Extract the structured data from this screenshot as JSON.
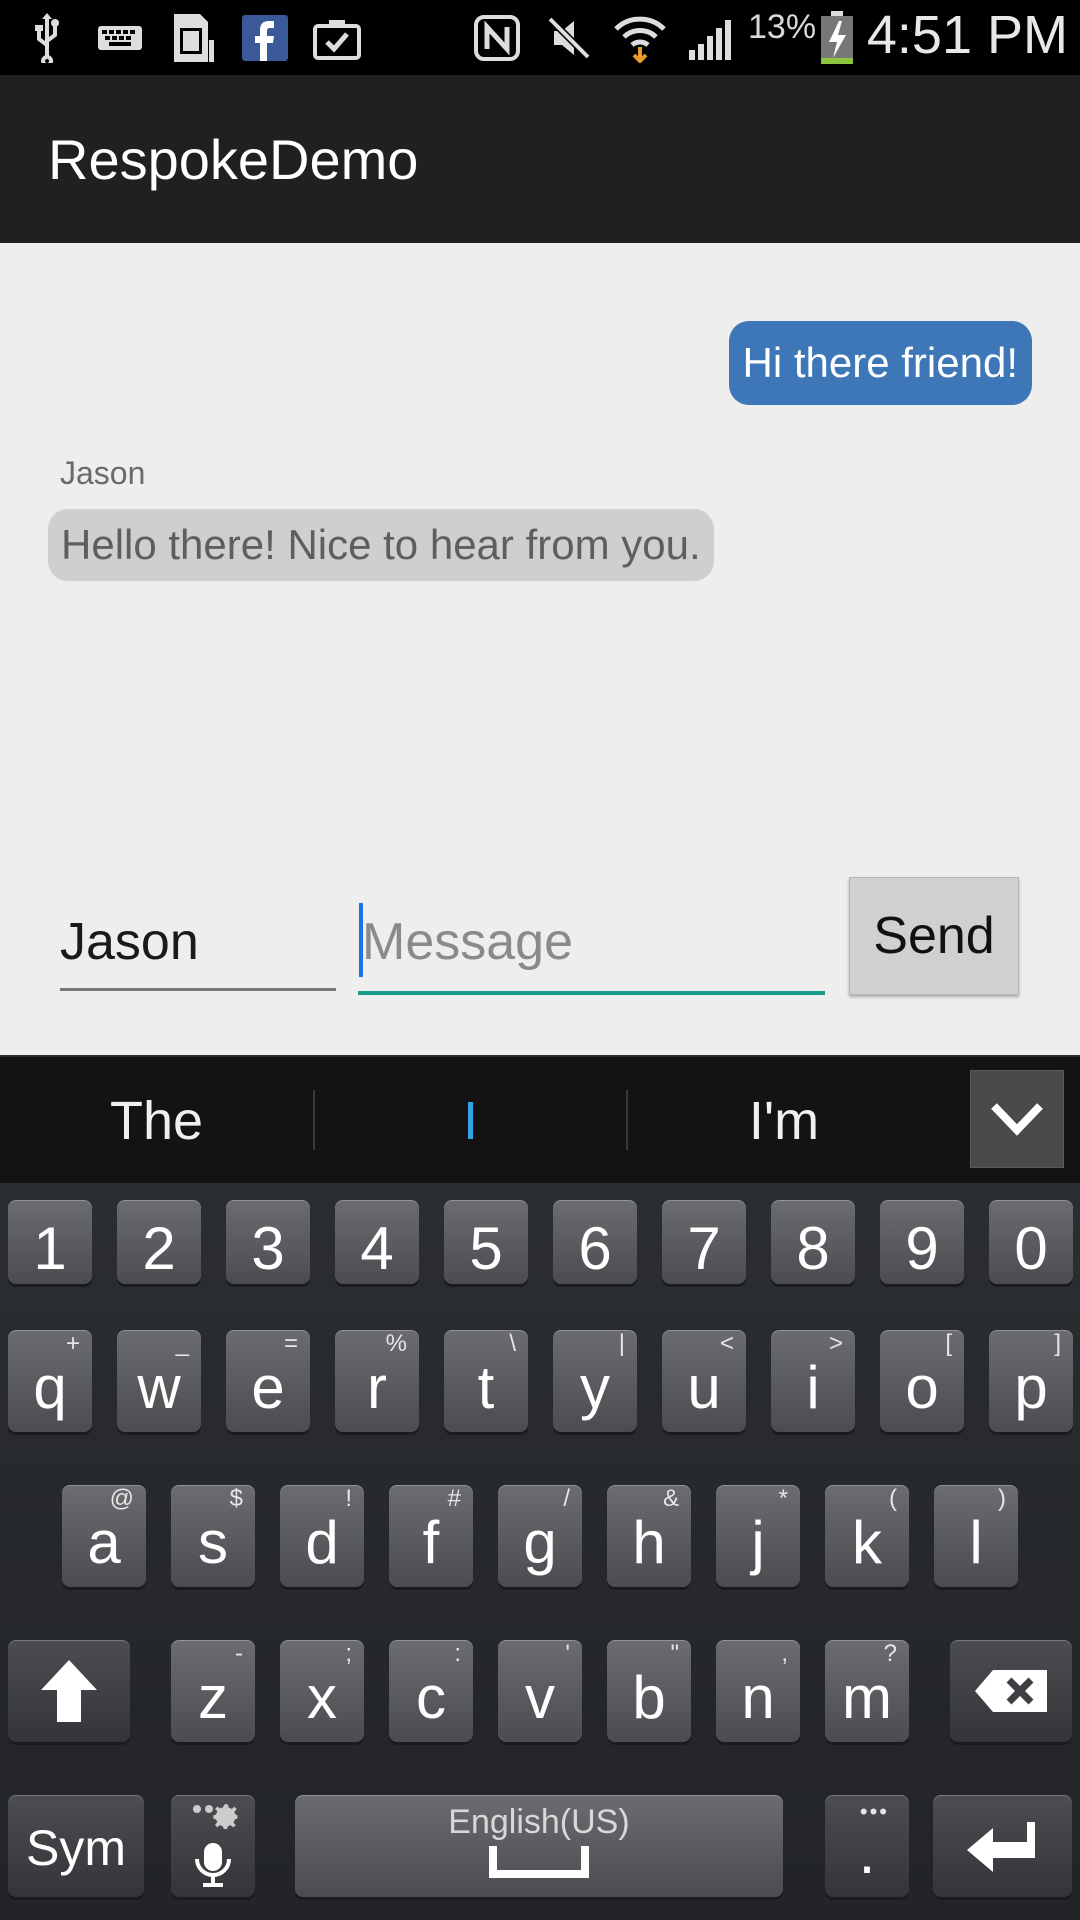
{
  "status_bar": {
    "icons": [
      "usb-icon",
      "keyboard-icon",
      "sd-card-icon",
      "facebook-icon",
      "clipboard-check-icon",
      "nfc-icon",
      "mute-icon",
      "wifi-icon",
      "signal-icon",
      "battery-charging-icon"
    ],
    "battery_percent": "13%",
    "time": "4:51 PM",
    "battery_level": 0.13
  },
  "action_bar": {
    "title": "RespokeDemo"
  },
  "chat": {
    "messages": [
      {
        "direction": "outgoing",
        "text": "Hi there friend!",
        "color": "#3d77b8"
      },
      {
        "direction": "incoming",
        "sender": "Jason",
        "text": "Hello there! Nice to hear from you.",
        "color": "#cfcfcf"
      }
    ]
  },
  "composer": {
    "name_value": "Jason",
    "message_placeholder": "Message",
    "send_label": "Send",
    "accent_color": "#169b8c"
  },
  "keyboard": {
    "suggestions": [
      "The",
      "I",
      "I'm"
    ],
    "number_row": [
      "1",
      "2",
      "3",
      "4",
      "5",
      "6",
      "7",
      "8",
      "9",
      "0"
    ],
    "row1": [
      {
        "key": "q",
        "hint": "+"
      },
      {
        "key": "w",
        "hint": "_"
      },
      {
        "key": "e",
        "hint": "="
      },
      {
        "key": "r",
        "hint": "%"
      },
      {
        "key": "t",
        "hint": "\\"
      },
      {
        "key": "y",
        "hint": "|"
      },
      {
        "key": "u",
        "hint": "<"
      },
      {
        "key": "i",
        "hint": ">"
      },
      {
        "key": "o",
        "hint": "["
      },
      {
        "key": "p",
        "hint": "]"
      }
    ],
    "row2": [
      {
        "key": "a",
        "hint": "@"
      },
      {
        "key": "s",
        "hint": "$"
      },
      {
        "key": "d",
        "hint": "!"
      },
      {
        "key": "f",
        "hint": "#"
      },
      {
        "key": "g",
        "hint": "/"
      },
      {
        "key": "h",
        "hint": "&"
      },
      {
        "key": "j",
        "hint": "*"
      },
      {
        "key": "k",
        "hint": "("
      },
      {
        "key": "l",
        "hint": ")"
      }
    ],
    "row3": [
      {
        "key": "z",
        "hint": "-"
      },
      {
        "key": "x",
        "hint": ";"
      },
      {
        "key": "c",
        "hint": ":"
      },
      {
        "key": "v",
        "hint": "'"
      },
      {
        "key": "b",
        "hint": "\""
      },
      {
        "key": "n",
        "hint": ","
      },
      {
        "key": "m",
        "hint": "?"
      }
    ],
    "sym_label": "Sym",
    "space_label": "English(US)",
    "period_label": "."
  }
}
